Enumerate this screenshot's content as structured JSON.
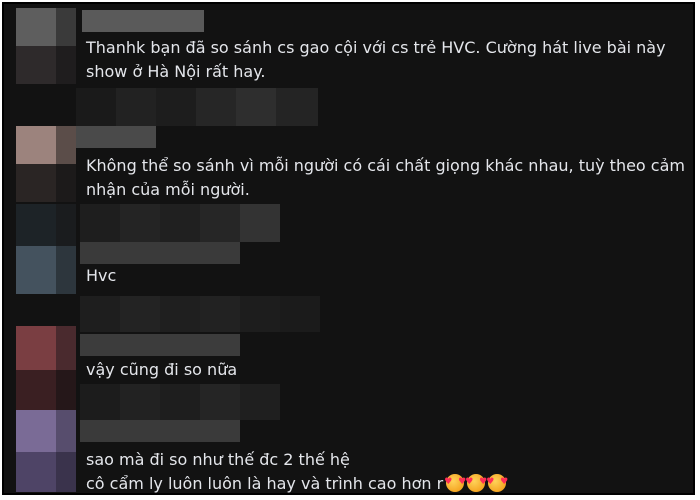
{
  "comments": [
    {
      "text": "Thanhk bạn đã so sánh cs gao cội với cs trẻ HVC. Cường hát live bài này show ở Hà Nội rất hay.",
      "lines": [
        "Thanhk bạn đã so sánh cs gao cội với cs trẻ HVC. Cường hát live bài này",
        "show ở Hà Nội rất hay."
      ]
    },
    {
      "text": "Không thể so sánh vì mỗi người có cái chất giọng khác nhau, tuỳ theo cảm nhận của mỗi người.",
      "lines": [
        "Không thể so sánh vì mỗi người có cái chất giọng khác nhau, tuỳ theo cảm",
        "nhận của mỗi người."
      ]
    },
    {
      "text": "Hvc",
      "lines": [
        "Hvc"
      ]
    },
    {
      "text": "vậy cũng đi so nữa",
      "lines": [
        "vậy cũng đi so nữa"
      ]
    },
    {
      "text": "sao mà đi so như thế đc 2 thế hệ cô cẩm ly luôn luôn là hay và trình cao hơn r",
      "lines": [
        "sao mà đi so như thế đc 2 thế hệ",
        "cô cẩm ly luôn luôn là hay và trình cao hơn r"
      ],
      "emojis": [
        "smiling-face-with-hearts",
        "smiling-face-with-hearts",
        "smiling-face-with-hearts"
      ]
    }
  ],
  "colors": {
    "background": "#121212",
    "text": "#e4e6eb",
    "border": "#000000"
  }
}
